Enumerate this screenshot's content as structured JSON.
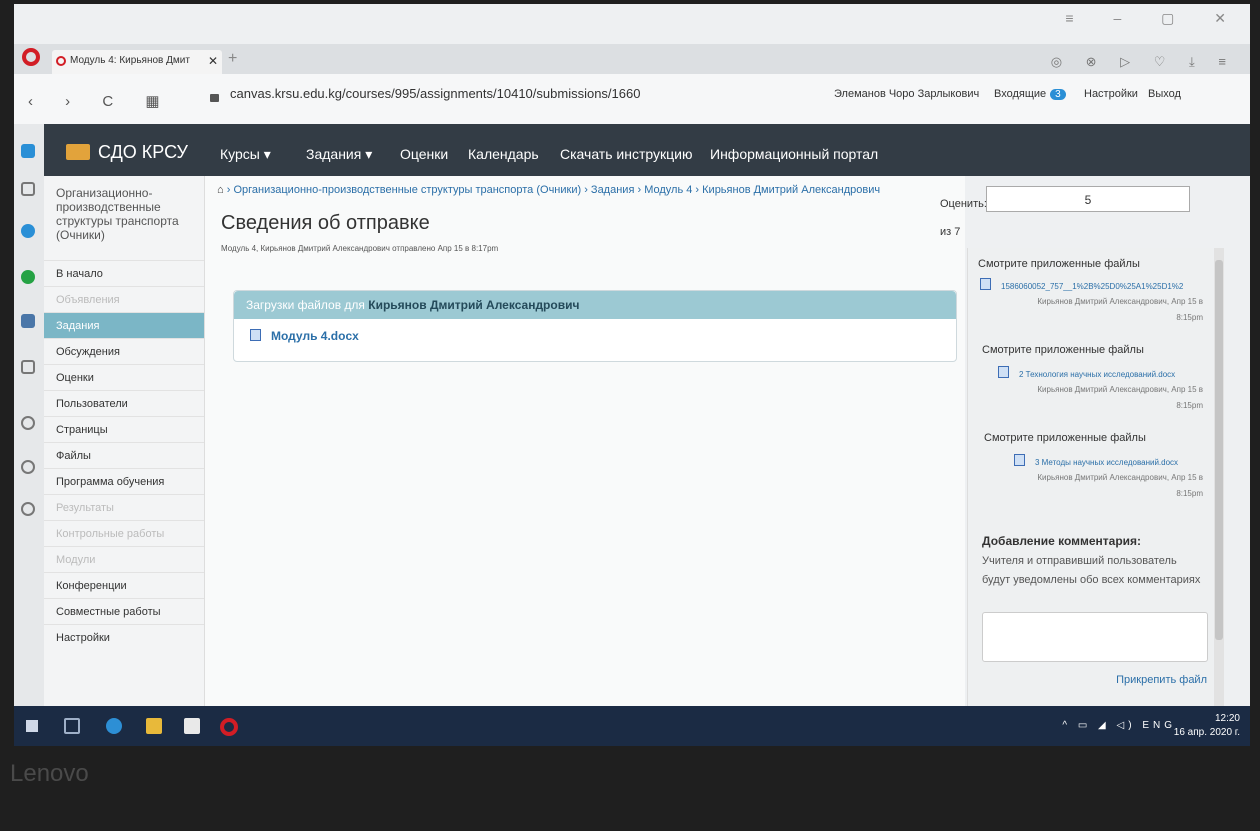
{
  "browser": {
    "tab_title": "Модуль 4: Кирьянов Дмит",
    "tab_close": "✕",
    "new_tab": "+",
    "url": "canvas.krsu.edu.kg/courses/995/assignments/10410/submissions/1660"
  },
  "header": {
    "user_name": "Элеманов Чоро Зарлыкович",
    "inbox_label": "Входящие",
    "inbox_count": "3",
    "settings_label": "Настройки",
    "logout_label": "Выход"
  },
  "topnav": {
    "brand": "СДО КРСУ",
    "items": [
      "Курсы ▾",
      "Задания ▾",
      "Оценки",
      "Календарь",
      "Скачать инструкцию",
      "Информационный портал"
    ]
  },
  "breadcrumb": {
    "home_icon": "home-icon",
    "items": [
      "Организационно-производственные структуры транспорта (Очники)",
      "Задания",
      "Модуль 4",
      "Кирьянов Дмитрий Александрович"
    ]
  },
  "course_menu": {
    "course_title": "Организационно-производственные структуры транспорта (Очники)",
    "items": [
      {
        "label": "В начало",
        "state": "normal"
      },
      {
        "label": "Объявления",
        "state": "dim"
      },
      {
        "label": "Задания",
        "state": "active"
      },
      {
        "label": "Обсуждения",
        "state": "normal"
      },
      {
        "label": "Оценки",
        "state": "normal"
      },
      {
        "label": "Пользователи",
        "state": "normal"
      },
      {
        "label": "Страницы",
        "state": "normal"
      },
      {
        "label": "Файлы",
        "state": "normal"
      },
      {
        "label": "Программа обучения",
        "state": "normal"
      },
      {
        "label": "Результаты",
        "state": "dim"
      },
      {
        "label": "Контрольные работы",
        "state": "dim"
      },
      {
        "label": "Модули",
        "state": "dim"
      },
      {
        "label": "Конференции",
        "state": "normal"
      },
      {
        "label": "Совместные работы",
        "state": "normal"
      },
      {
        "label": "Настройки",
        "state": "normal"
      }
    ]
  },
  "main": {
    "title": "Сведения об отправке",
    "subline": "Модуль 4, Кирьянов Дмитрий Александрович   отправлено Апр 15 в 8:17pm",
    "uploads_prefix": "Загрузки файлов для",
    "uploads_student": "Кирьянов Дмитрий Александрович",
    "file_name": "Модуль 4.docx"
  },
  "grading": {
    "label": "Оценить:",
    "value": "5",
    "out_of": "из 7"
  },
  "attachments": {
    "head": "Смотрите приложенные файлы",
    "items": [
      {
        "file": "1586060052_757__1%2B%25D0%25A1%25D1%2",
        "meta_name": "Кирьянов Дмитрий Александрович, Апр 15 в",
        "meta_time": "8:15pm"
      },
      {
        "file": "2 Технология научных исследований.docx",
        "meta_name": "Кирьянов Дмитрий Александрович, Апр 15 в",
        "meta_time": "8:15pm"
      },
      {
        "file": "3 Методы научных исследований.docx",
        "meta_name": "Кирьянов Дмитрий Александрович, Апр 15 в",
        "meta_time": "8:15pm"
      }
    ]
  },
  "comments": {
    "title": "Добавление комментария:",
    "note": "Учителя и отправивший пользователь будут уведомлены обо всех комментариях",
    "attach_label": "Прикрепить файл"
  },
  "taskbar": {
    "lang": "ENG",
    "time": "12:20",
    "date": "16 апр. 2020 г."
  },
  "device_label": "Lenovo",
  "colors": {
    "topnav": "#333c45",
    "menu_active": "#7bb6c6",
    "uploads_header": "#9cc9d3",
    "link": "#2b6fa8",
    "taskbar": "#1b2b44",
    "opera": "#d21d25"
  }
}
